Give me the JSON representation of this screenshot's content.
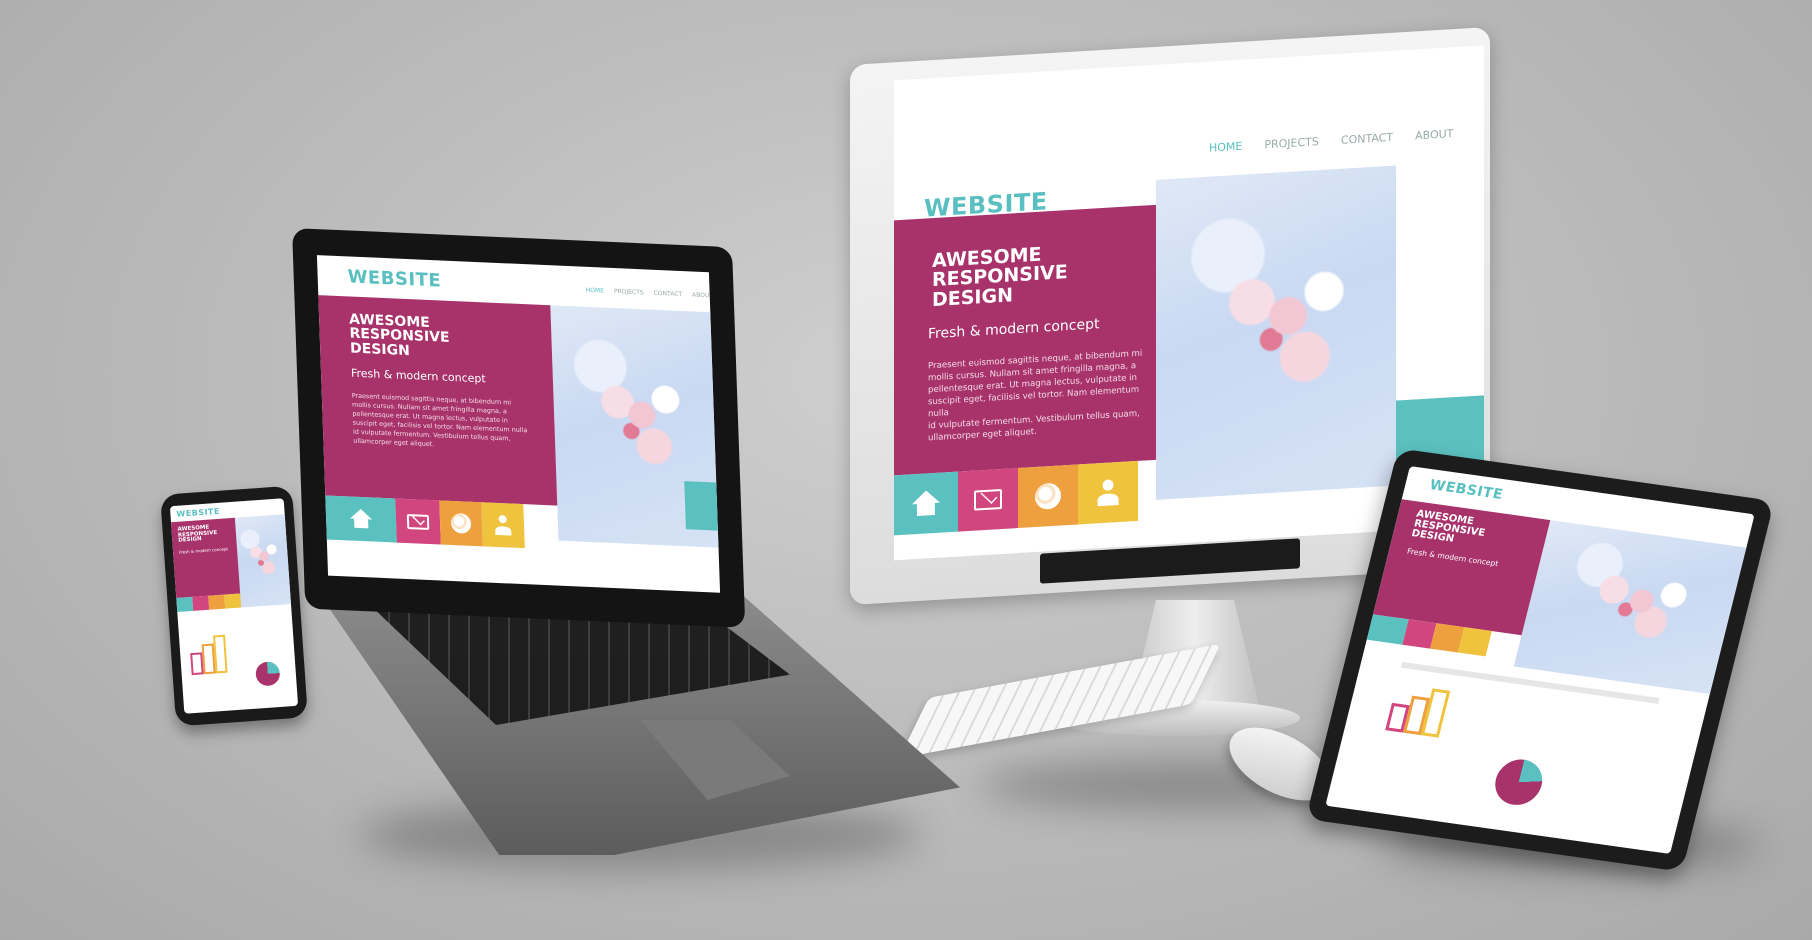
{
  "site": {
    "logo": "WEBSITE",
    "nav": [
      "HOME",
      "PROJECTS",
      "CONTACT",
      "ABOUT"
    ],
    "headline_lines": [
      "AWESOME",
      "RESPONSIVE",
      "DESIGN"
    ],
    "subheadline": "Fresh & modern concept",
    "body_lines": [
      "Praesent euismod sagittis neque, at bibendum mi",
      "mollis cursus. Nullam sit amet fringilla magna, a",
      "pellentesque erat. Ut magna lectus, vulputate in",
      "suscipit eget, facilisis vel tortor. Nam elementum nulla",
      "id vulputate fermentum. Vestibulum tellus quam,",
      "ullamcorper eget aliquet."
    ],
    "icons": [
      "home-icon",
      "mail-icon",
      "globe-icon",
      "user-icon"
    ]
  },
  "colors": {
    "brand_magenta": "#a8336b",
    "teal": "#5bc1c0",
    "pink": "#d2467f",
    "orange": "#ee9f3e",
    "yellow": "#efc33e",
    "background": "#bdbdbd"
  }
}
